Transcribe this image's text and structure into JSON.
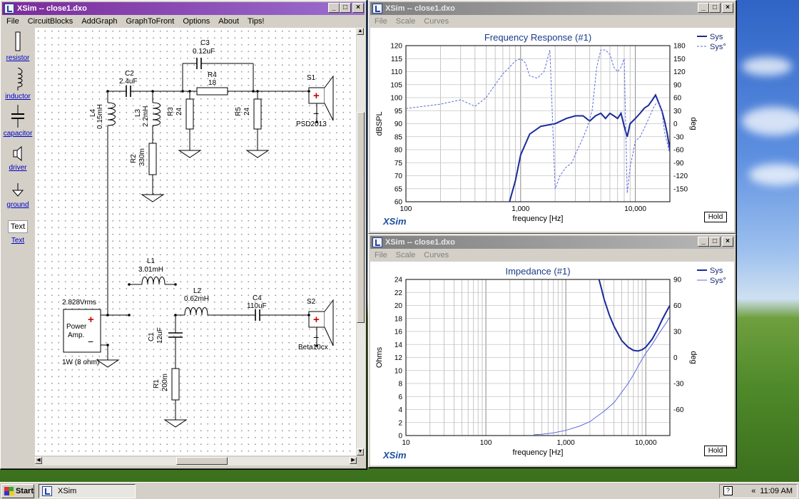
{
  "schematic_window": {
    "title": "XSim -- close1.dxo",
    "menu": [
      "File",
      "CircuitBlocks",
      "AddGraph",
      "GraphToFront",
      "Options",
      "About",
      "Tips!"
    ],
    "palette": [
      {
        "label": "resistor",
        "icon": "resistor-icon"
      },
      {
        "label": "inductor",
        "icon": "inductor-icon"
      },
      {
        "label": "capacitor",
        "icon": "capacitor-icon"
      },
      {
        "label": "driver",
        "icon": "driver-icon"
      },
      {
        "label": "ground",
        "icon": "ground-icon"
      },
      {
        "label": "Text",
        "icon": "text-icon",
        "box": "Text"
      }
    ],
    "components": {
      "C3": {
        "name": "C3",
        "value": "0.12uF"
      },
      "C2": {
        "name": "C2",
        "value": "2.4uF"
      },
      "R4": {
        "name": "R4",
        "value": "18"
      },
      "S1": {
        "name": "S1",
        "value": "PSD2013"
      },
      "L4": {
        "name": "L4",
        "value": "0.15mH"
      },
      "L3": {
        "name": "L3",
        "value": "2.2mH"
      },
      "R3": {
        "name": "R3",
        "value": "24"
      },
      "R5": {
        "name": "R5",
        "value": "24"
      },
      "R2": {
        "name": "R2",
        "value": "330m"
      },
      "L1": {
        "name": "L1",
        "value": "3.01mH"
      },
      "L2": {
        "name": "L2",
        "value": "0.62mH"
      },
      "C4": {
        "name": "C4",
        "value": "110uF"
      },
      "S2": {
        "name": "S2",
        "value": "Beta10cx"
      },
      "C1": {
        "name": "C1",
        "value": "12uF"
      },
      "R1": {
        "name": "R1",
        "value": "200m"
      },
      "amp": {
        "voltage": "2.828Vrms",
        "line1": "Power",
        "line2": "Amp.",
        "power": "1W (8 ohm)",
        "plus": "+",
        "minus": "−"
      }
    }
  },
  "freq_window": {
    "title": "XSim -- close1.dxo",
    "menu": [
      "File",
      "Scale",
      "Curves"
    ],
    "hold_label": "Hold",
    "brand": "XSim"
  },
  "imp_window": {
    "title": "XSim -- close1.dxo",
    "menu": [
      "File",
      "Scale",
      "Curves"
    ],
    "hold_label": "Hold",
    "brand": "XSim"
  },
  "chart_data": [
    {
      "type": "line",
      "title": "Frequency Response (#1)",
      "xlabel": "frequency [Hz]",
      "ylabel": "dBSPL",
      "y2label": "deg",
      "xscale": "log",
      "xlim": [
        100,
        20000
      ],
      "ylim": [
        60,
        120
      ],
      "y2lim": [
        -180,
        180
      ],
      "x_ticks": [
        100,
        1000,
        10000
      ],
      "x_tick_labels": [
        "100",
        "1,000",
        "10,000"
      ],
      "y_ticks": [
        60,
        65,
        70,
        75,
        80,
        85,
        90,
        95,
        100,
        105,
        110,
        115,
        120
      ],
      "y2_ticks": [
        -150,
        -120,
        -90,
        -60,
        -30,
        0,
        30,
        60,
        90,
        120,
        150,
        180
      ],
      "grid": true,
      "legend": "top-right",
      "series": [
        {
          "name": "Sys",
          "axis": "y",
          "style": "solid",
          "color": "#1a2a9a",
          "x": [
            800,
            900,
            1000,
            1200,
            1500,
            2000,
            2500,
            3000,
            3500,
            4000,
            4500,
            5000,
            5500,
            6000,
            6500,
            7000,
            7500,
            8000,
            8500,
            9000,
            10000,
            11000,
            12000,
            13000,
            14000,
            15000,
            16000,
            17000,
            18000,
            19000,
            20000
          ],
          "values": [
            60,
            68,
            78,
            86,
            89,
            90,
            92,
            93,
            93,
            91,
            93,
            94,
            92,
            94,
            93,
            92,
            94,
            89,
            85,
            90,
            92,
            94,
            96,
            97,
            99,
            101,
            98,
            95,
            91,
            86,
            80
          ]
        },
        {
          "name": "Sys°",
          "axis": "y2",
          "style": "dashed",
          "color": "#5a6adb",
          "x": [
            100,
            200,
            300,
            400,
            500,
            600,
            700,
            800,
            900,
            1000,
            1100,
            1200,
            1400,
            1600,
            1800,
            2000,
            2200,
            2500,
            2800,
            3000,
            3400,
            3800,
            4200,
            4600,
            5000,
            5500,
            6000,
            6500,
            7000,
            7500,
            8000,
            8500,
            9000,
            9500,
            10000,
            11000,
            12000,
            13000,
            14000,
            15000,
            16000,
            17000,
            18000,
            20000
          ],
          "values": [
            35,
            45,
            55,
            40,
            60,
            90,
            115,
            130,
            145,
            150,
            140,
            110,
            105,
            120,
            170,
            -150,
            -120,
            -100,
            -90,
            -70,
            -40,
            -10,
            30,
            130,
            170,
            170,
            160,
            130,
            120,
            130,
            150,
            -160,
            -100,
            -70,
            -40,
            -30,
            -10,
            10,
            30,
            45,
            50,
            30,
            -20,
            -70
          ]
        }
      ]
    },
    {
      "type": "line",
      "title": "Impedance (#1)",
      "xlabel": "frequency [Hz]",
      "ylabel": "Ohms",
      "y2label": "deg",
      "xscale": "log",
      "xlim": [
        10,
        20000
      ],
      "ylim": [
        0,
        24
      ],
      "y2lim": [
        -90,
        90
      ],
      "x_ticks": [
        10,
        100,
        1000,
        10000
      ],
      "x_tick_labels": [
        "10",
        "100",
        "1,000",
        "10,000"
      ],
      "y_ticks": [
        0,
        2,
        4,
        6,
        8,
        10,
        12,
        14,
        16,
        18,
        20,
        22,
        24
      ],
      "y2_ticks": [
        -60,
        -30,
        0,
        30,
        60,
        90
      ],
      "grid": true,
      "legend": "top-right",
      "series": [
        {
          "name": "Sys",
          "axis": "y",
          "style": "solid",
          "color": "#1a2a9a",
          "x": [
            2600,
            2800,
            3000,
            3500,
            4000,
            5000,
            6000,
            7000,
            8000,
            9000,
            10000,
            12000,
            14000,
            16000,
            18000,
            20000
          ],
          "values": [
            24,
            22.5,
            21,
            18.5,
            16.8,
            14.6,
            13.6,
            13.1,
            13.0,
            13.2,
            13.6,
            14.8,
            16.3,
            17.8,
            19.0,
            20.0
          ]
        },
        {
          "name": "Sys°",
          "axis": "y2",
          "style": "solid",
          "color": "#5a6adb",
          "x": [
            400,
            500,
            700,
            1000,
            1500,
            2000,
            3000,
            4000,
            5000,
            6000,
            7000,
            8000,
            9000,
            10000,
            12000,
            14000,
            16000,
            18000,
            20000
          ],
          "values": [
            -89,
            -88.5,
            -87,
            -84,
            -79,
            -74,
            -62,
            -52,
            -40,
            -30,
            -20,
            -10,
            -2,
            5,
            15,
            25,
            33,
            40,
            47
          ]
        }
      ]
    }
  ],
  "taskbar": {
    "start_label": "Start",
    "task_label": "XSim",
    "clock": "11:09 AM",
    "chevron": "«",
    "help": "?"
  }
}
